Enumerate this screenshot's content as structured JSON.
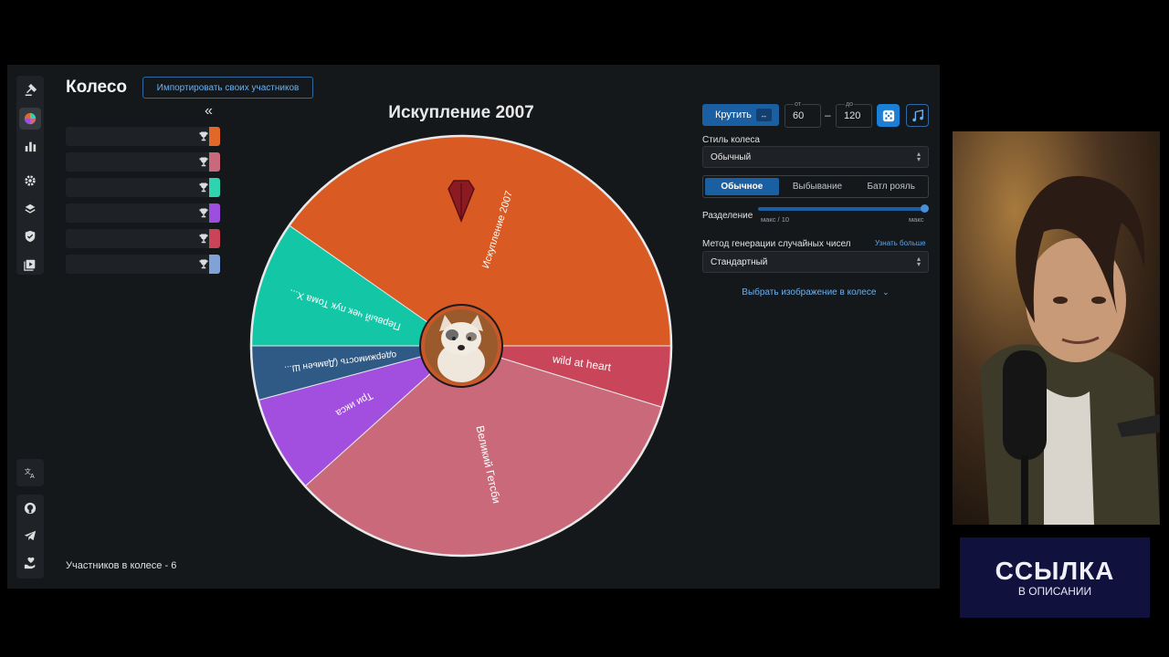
{
  "app": {
    "title": "Колесо",
    "import_button": "Импортировать своих участников",
    "collapse_glyph": "«",
    "participants_count": "Участников в колесе - 6"
  },
  "rail": {
    "top": [
      {
        "name": "auction-icon",
        "active": false
      },
      {
        "name": "wheel-icon",
        "active": true
      },
      {
        "name": "bar-chart-icon",
        "active": false
      },
      {
        "name": "gear-icon",
        "active": false
      },
      {
        "name": "layers-icon",
        "active": false
      },
      {
        "name": "shield-icon",
        "active": false
      },
      {
        "name": "video-library-icon",
        "active": false
      }
    ],
    "lang": "translate-icon",
    "bottom": [
      "github-icon",
      "telegram-icon",
      "donate-icon"
    ]
  },
  "participants": [
    {
      "color": "#e0692a"
    },
    {
      "color": "#c9697b"
    },
    {
      "color": "#2ed4b0"
    },
    {
      "color": "#9b4ee0"
    },
    {
      "color": "#c94458"
    },
    {
      "color": "#7fa3d6"
    }
  ],
  "wheel": {
    "title": "Искупление 2007",
    "segments": [
      {
        "label": "Искупление 2007",
        "color": "#d95a22"
      },
      {
        "label": "wild at heart",
        "color": "#c8455a"
      },
      {
        "label": "Великий Гетсби",
        "color": "#c9697a"
      },
      {
        "label": "Три икса",
        "color": "#a24fe0"
      },
      {
        "label": "одержимость (Дамьен Ш...",
        "color": "#2f5a86"
      },
      {
        "label": "Первый чек пук Тома Х...",
        "color": "#13c6a6"
      }
    ]
  },
  "controls": {
    "spin_button": "Крутить",
    "spin_sub": "↔",
    "from_label": "от",
    "from_value": "60",
    "dash": "–",
    "to_label": "до",
    "to_value": "120",
    "dice_icon": "dice-icon",
    "music_icon": "music-icon",
    "wheel_style_label": "Стиль колеса",
    "wheel_style_value": "Обычный",
    "modes": [
      "Обычное",
      "Выбывание",
      "Батл рояль"
    ],
    "active_mode": 0,
    "split_label": "Разделение",
    "split_min": "макс / 10",
    "split_max": "макс",
    "split_level": 1.0,
    "rng_label": "Метод генерации случайных чисел",
    "learn_more": "Узнать больше",
    "rng_value": "Стандартный",
    "choose_image": "Выбрать изображение в колесе"
  },
  "banner": {
    "big": "ССЫЛКА",
    "small": "В ОПИСАНИИ"
  }
}
